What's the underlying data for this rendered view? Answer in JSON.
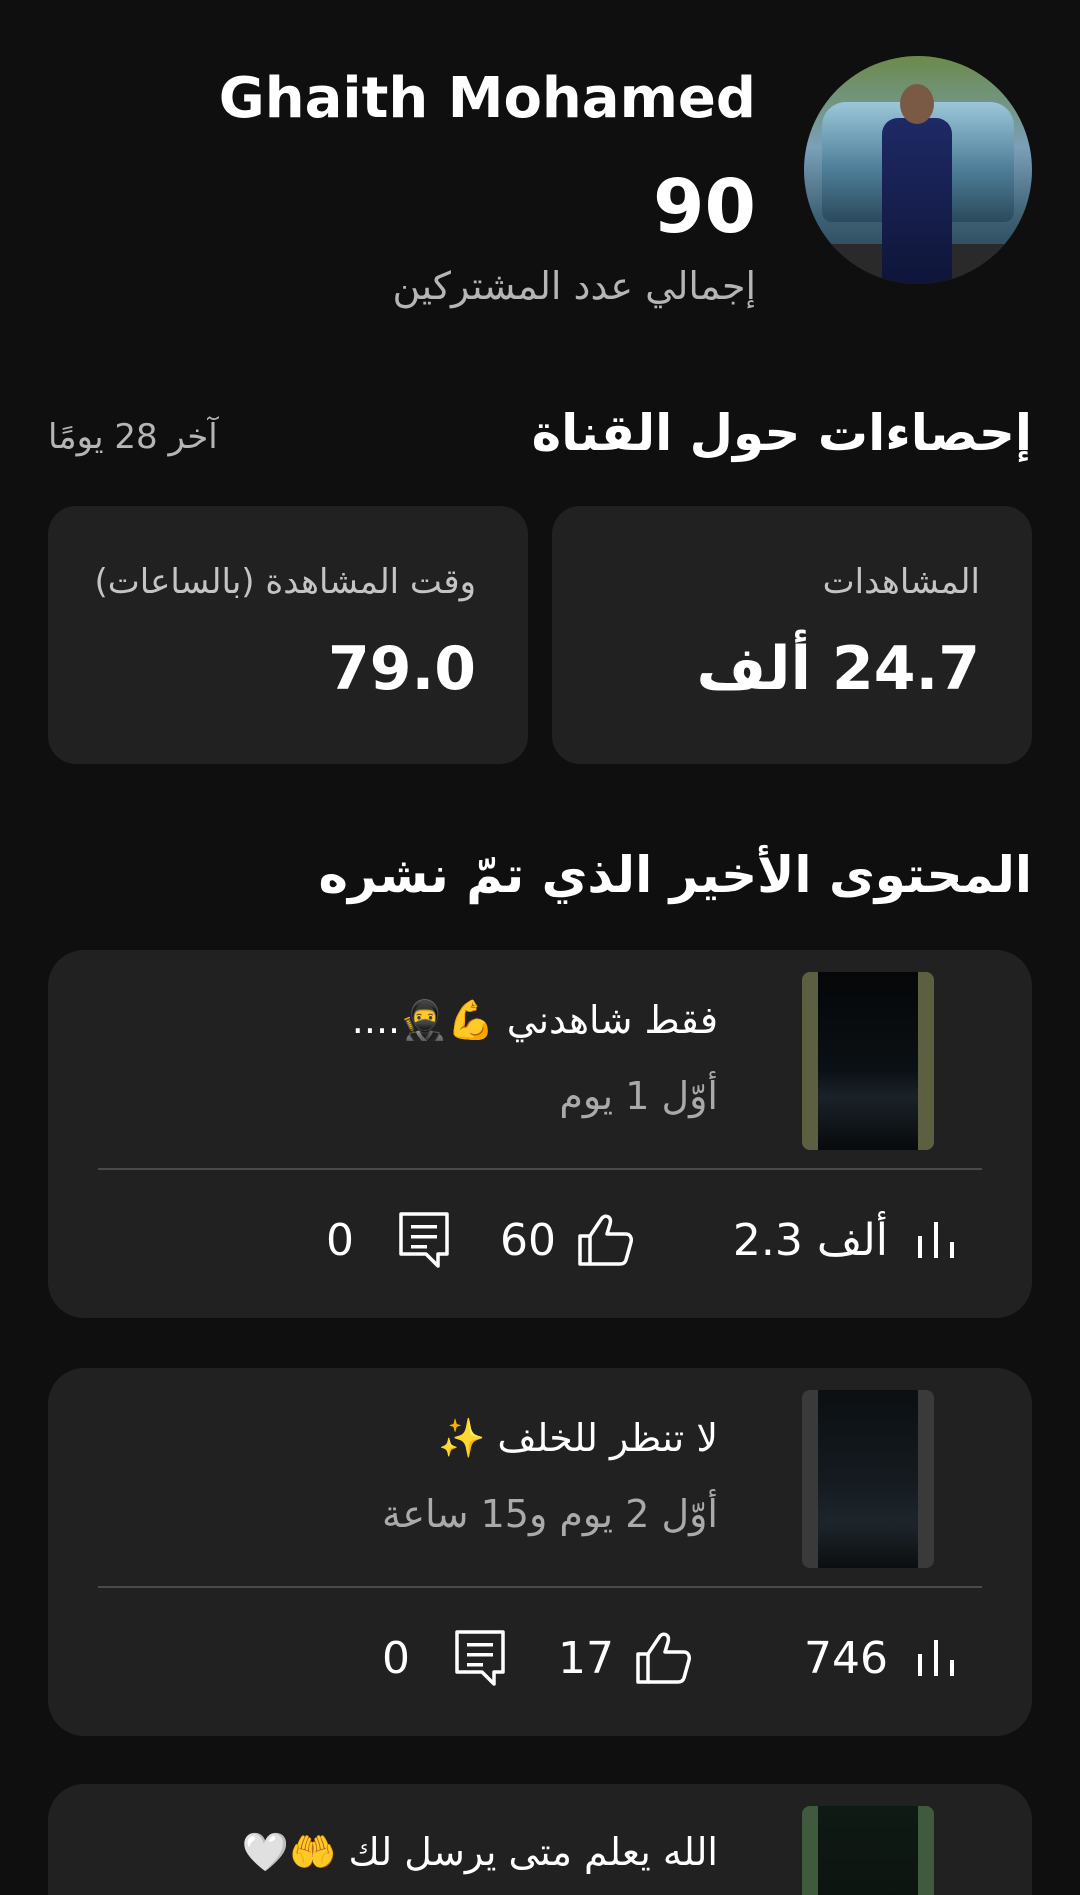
{
  "header": {
    "channel_name": "Ghaith Mohamed",
    "subscriber_count": "90",
    "subscriber_label": "إجمالي عدد المشتركين"
  },
  "stats": {
    "title": "إحصاءات حول القناة",
    "period": "آخر 28 يومًا",
    "views": {
      "label": "المشاهدات",
      "value": "24.7 ألف"
    },
    "watch_time": {
      "label": "وقت المشاهدة (بالساعات)",
      "value": "79.0"
    }
  },
  "recent": {
    "title": "المحتوى الأخير الذي تمّ نشره",
    "items": [
      {
        "title": "فقط شاهدني 💪🥷....",
        "age": "أوّل 1 يوم",
        "views": "2.3 ألف",
        "likes": "60",
        "comments": "0"
      },
      {
        "title": "لا تنظر للخلف ✨",
        "age": "أوّل 2 يوم و15 ساعة",
        "views": "746",
        "likes": "17",
        "comments": "0"
      },
      {
        "title": "الله يعلم متى يرسل لك 🤲🤍"
      }
    ]
  },
  "colors": {
    "background": "#0f0f0f",
    "card": "#212121",
    "secondary_text": "#aaaaaa"
  },
  "icons": [
    "views-bars-icon",
    "thumb-up-icon",
    "comment-icon"
  ]
}
